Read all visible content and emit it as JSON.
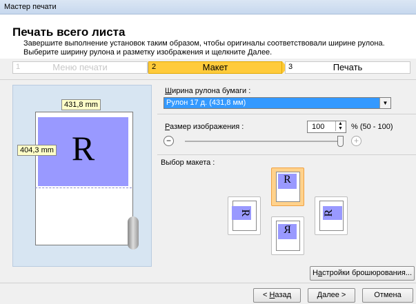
{
  "window": {
    "title": "Мастер печати"
  },
  "header": {
    "title": "Печать всего листа",
    "desc_line1": "Завершите выполнение установок таким образом, чтобы оригиналы соответствовали ширине рулона.",
    "desc_line2": "Выберите ширину рулона и разметку изображения и щелкните Далее."
  },
  "steps": [
    {
      "num": "1",
      "label": "Меню печати",
      "state": "done"
    },
    {
      "num": "2",
      "label": "Макет",
      "state": "active"
    },
    {
      "num": "3",
      "label": "Печать",
      "state": "pending"
    }
  ],
  "preview": {
    "width_label": "431,8 mm",
    "height_label": "404,3 mm",
    "letter": "R"
  },
  "roll_width": {
    "label": "Ширина рулона бумаги :",
    "label_ul": "Ш",
    "label_rest": "ирина рулона бумаги :",
    "value": "Рулон 17 д. (431,8 мм)"
  },
  "image_size": {
    "label_ul": "Р",
    "label_rest": "азмер изображения :",
    "value": "100",
    "unit": "% (50 - 100)",
    "level_percent": 100
  },
  "layout": {
    "label": "Выбор макета :",
    "letter": "R"
  },
  "binding_button": {
    "ul": "а",
    "pre": "Н",
    "post": "стройки брошюрования..."
  },
  "footer": {
    "back": {
      "pre": "< ",
      "ul": "Н",
      "post": "азад"
    },
    "next": {
      "ul": "Д",
      "post": "алее >"
    },
    "cancel": "Отмена"
  },
  "colors": {
    "accent": "#ffcb3b",
    "image": "#9999ff",
    "selection": "#3399ff"
  }
}
